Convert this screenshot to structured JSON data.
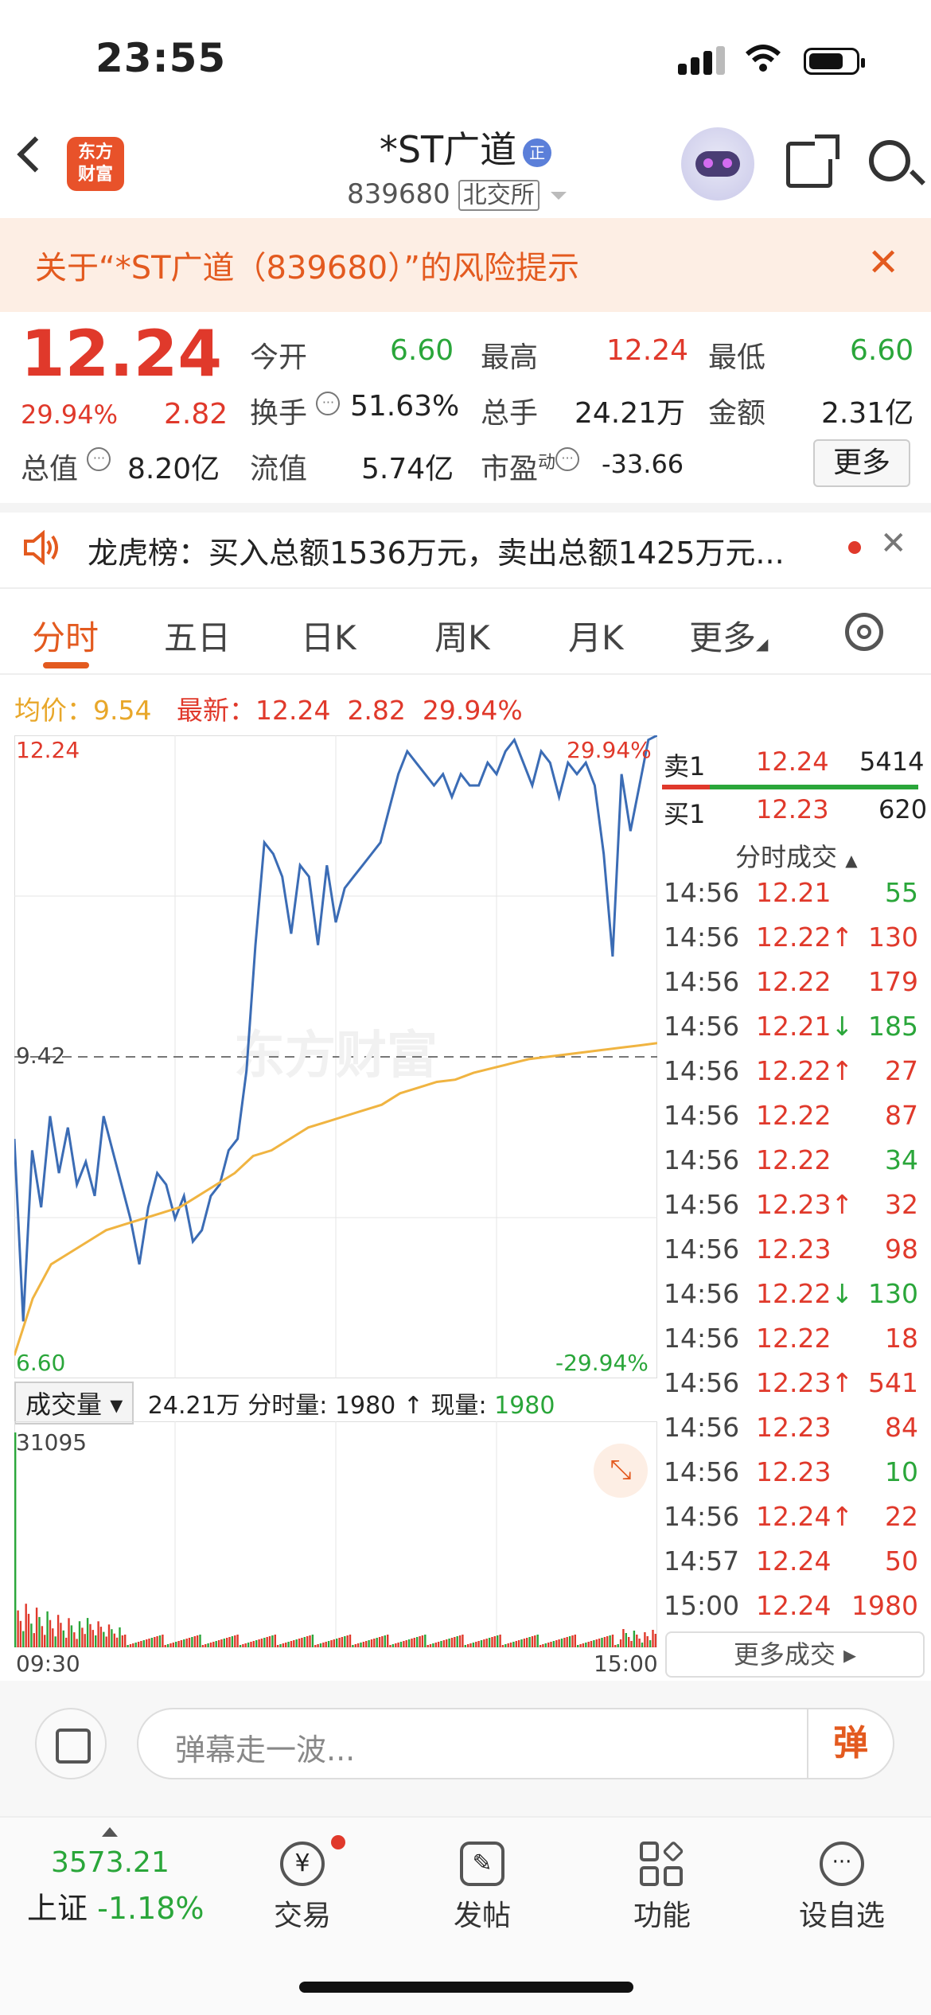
{
  "status": {
    "time": "23:55"
  },
  "header": {
    "logo_text": "东方\n财富",
    "stock_name": "*ST广道",
    "qualifier_badge": "正",
    "code": "839680",
    "exchange": "北交所"
  },
  "risk_banner": {
    "text": "关于“*ST广道（839680）”的风险提示"
  },
  "quote": {
    "price": "12.24",
    "change_pct": "29.94%",
    "change": "2.82",
    "fields": [
      {
        "label": "今开",
        "value": "6.60",
        "color": "green"
      },
      {
        "label": "最高",
        "value": "12.24",
        "color": "red"
      },
      {
        "label": "最低",
        "value": "6.60",
        "color": "green"
      },
      {
        "label": "换手",
        "value": "51.63%",
        "color": "normal"
      },
      {
        "label": "总手",
        "value": "24.21万",
        "color": "normal"
      },
      {
        "label": "金额",
        "value": "2.31亿",
        "color": "normal"
      },
      {
        "label": "总值",
        "value": "8.20亿",
        "color": "normal"
      },
      {
        "label": "流值",
        "value": "5.74亿",
        "color": "normal"
      },
      {
        "label": "市盈",
        "sup": "动",
        "value": "-33.66",
        "color": "normal"
      }
    ],
    "more_label": "更多"
  },
  "lhb": {
    "text": "龙虎榜：买入总额1536万元，卖出总额1425万元..."
  },
  "tabs": [
    "分时",
    "五日",
    "日K",
    "周K",
    "月K",
    "更多"
  ],
  "chart_info": {
    "avg_label": "均价：",
    "avg": "9.54",
    "latest_label": "最新：",
    "latest": "12.24",
    "change": "2.82",
    "pct": "29.94%"
  },
  "chart_data": {
    "type": "line",
    "y_top": "12.24",
    "y_mid": "9.42",
    "y_bottom": "6.60",
    "pct_top": "29.94%",
    "pct_bottom": "-29.94%",
    "x_start": "09:30",
    "x_end": "15:00",
    "ylim": [
      6.6,
      12.24
    ],
    "series": [
      {
        "values": [
          8.7,
          7.1,
          8.6,
          8.1,
          8.9,
          8.4,
          8.8,
          8.3,
          8.5,
          8.2,
          8.9,
          8.6,
          8.3,
          8.0,
          7.6,
          8.1,
          8.4,
          8.3,
          8.0,
          8.2,
          7.8,
          7.9,
          8.2,
          8.3,
          8.6,
          8.7,
          9.3,
          10.4,
          11.3,
          11.2,
          11.0,
          10.5,
          11.1,
          11.0,
          10.4,
          11.1,
          10.6,
          10.9,
          11.0,
          11.1,
          11.2,
          11.3,
          11.6,
          11.9,
          12.1,
          12.0,
          11.9,
          11.8,
          11.9,
          11.7,
          11.9,
          11.8,
          11.8,
          12.0,
          11.9,
          12.1,
          12.2,
          12.0,
          11.8,
          12.1,
          12.0,
          11.7,
          12.0,
          11.9,
          12.0,
          11.8,
          11.2,
          10.3,
          11.9,
          11.4,
          11.8,
          12.2,
          12.24
        ]
      },
      {
        "values": [
          6.8,
          7.3,
          7.6,
          7.7,
          7.8,
          7.9,
          7.95,
          8.0,
          8.05,
          8.1,
          8.2,
          8.3,
          8.4,
          8.55,
          8.6,
          8.7,
          8.8,
          8.85,
          8.9,
          8.95,
          9.0,
          9.1,
          9.15,
          9.2,
          9.22,
          9.28,
          9.32,
          9.36,
          9.4,
          9.42,
          9.44,
          9.46,
          9.48,
          9.5,
          9.52,
          9.54
        ]
      }
    ],
    "volume_max": "31095"
  },
  "volume_header": {
    "select": "成交量",
    "total": "24.21万",
    "period_label": "分时量:",
    "period": "1980",
    "now_label": "现量:",
    "now": "1980"
  },
  "orderbook": {
    "sell1": {
      "label": "卖1",
      "price": "12.24",
      "vol": "5414"
    },
    "buy1": {
      "label": "买1",
      "price": "12.23",
      "vol": "620"
    },
    "ticks_title": "分时成交",
    "ticks": [
      {
        "t": "14:56",
        "p": "12.21",
        "d": "",
        "v": "55",
        "vc": "green"
      },
      {
        "t": "14:56",
        "p": "12.22",
        "d": "↑",
        "v": "130",
        "vc": "red"
      },
      {
        "t": "14:56",
        "p": "12.22",
        "d": "",
        "v": "179",
        "vc": "red"
      },
      {
        "t": "14:56",
        "p": "12.21",
        "d": "↓",
        "v": "185",
        "vc": "green"
      },
      {
        "t": "14:56",
        "p": "12.22",
        "d": "↑",
        "v": "27",
        "vc": "red"
      },
      {
        "t": "14:56",
        "p": "12.22",
        "d": "",
        "v": "87",
        "vc": "red"
      },
      {
        "t": "14:56",
        "p": "12.22",
        "d": "",
        "v": "34",
        "vc": "green"
      },
      {
        "t": "14:56",
        "p": "12.23",
        "d": "↑",
        "v": "32",
        "vc": "red"
      },
      {
        "t": "14:56",
        "p": "12.23",
        "d": "",
        "v": "98",
        "vc": "red"
      },
      {
        "t": "14:56",
        "p": "12.22",
        "d": "↓",
        "v": "130",
        "vc": "green"
      },
      {
        "t": "14:56",
        "p": "12.22",
        "d": "",
        "v": "18",
        "vc": "red"
      },
      {
        "t": "14:56",
        "p": "12.23",
        "d": "↑",
        "v": "541",
        "vc": "red"
      },
      {
        "t": "14:56",
        "p": "12.23",
        "d": "",
        "v": "84",
        "vc": "red"
      },
      {
        "t": "14:56",
        "p": "12.23",
        "d": "",
        "v": "10",
        "vc": "green"
      },
      {
        "t": "14:56",
        "p": "12.24",
        "d": "↑",
        "v": "22",
        "vc": "red"
      },
      {
        "t": "14:57",
        "p": "12.24",
        "d": "",
        "v": "50",
        "vc": "red"
      },
      {
        "t": "15:00",
        "p": "12.24",
        "d": "",
        "v": "1980",
        "vc": "red"
      }
    ],
    "more_ticks": "更多成交 ▸"
  },
  "comment": {
    "placeholder": "弹幕走一波...",
    "danmu": "弹"
  },
  "nav": {
    "index_value": "3573.21",
    "index_name": "上证",
    "index_change": "-1.18%",
    "items": [
      "交易",
      "发帖",
      "功能",
      "设自选"
    ]
  }
}
